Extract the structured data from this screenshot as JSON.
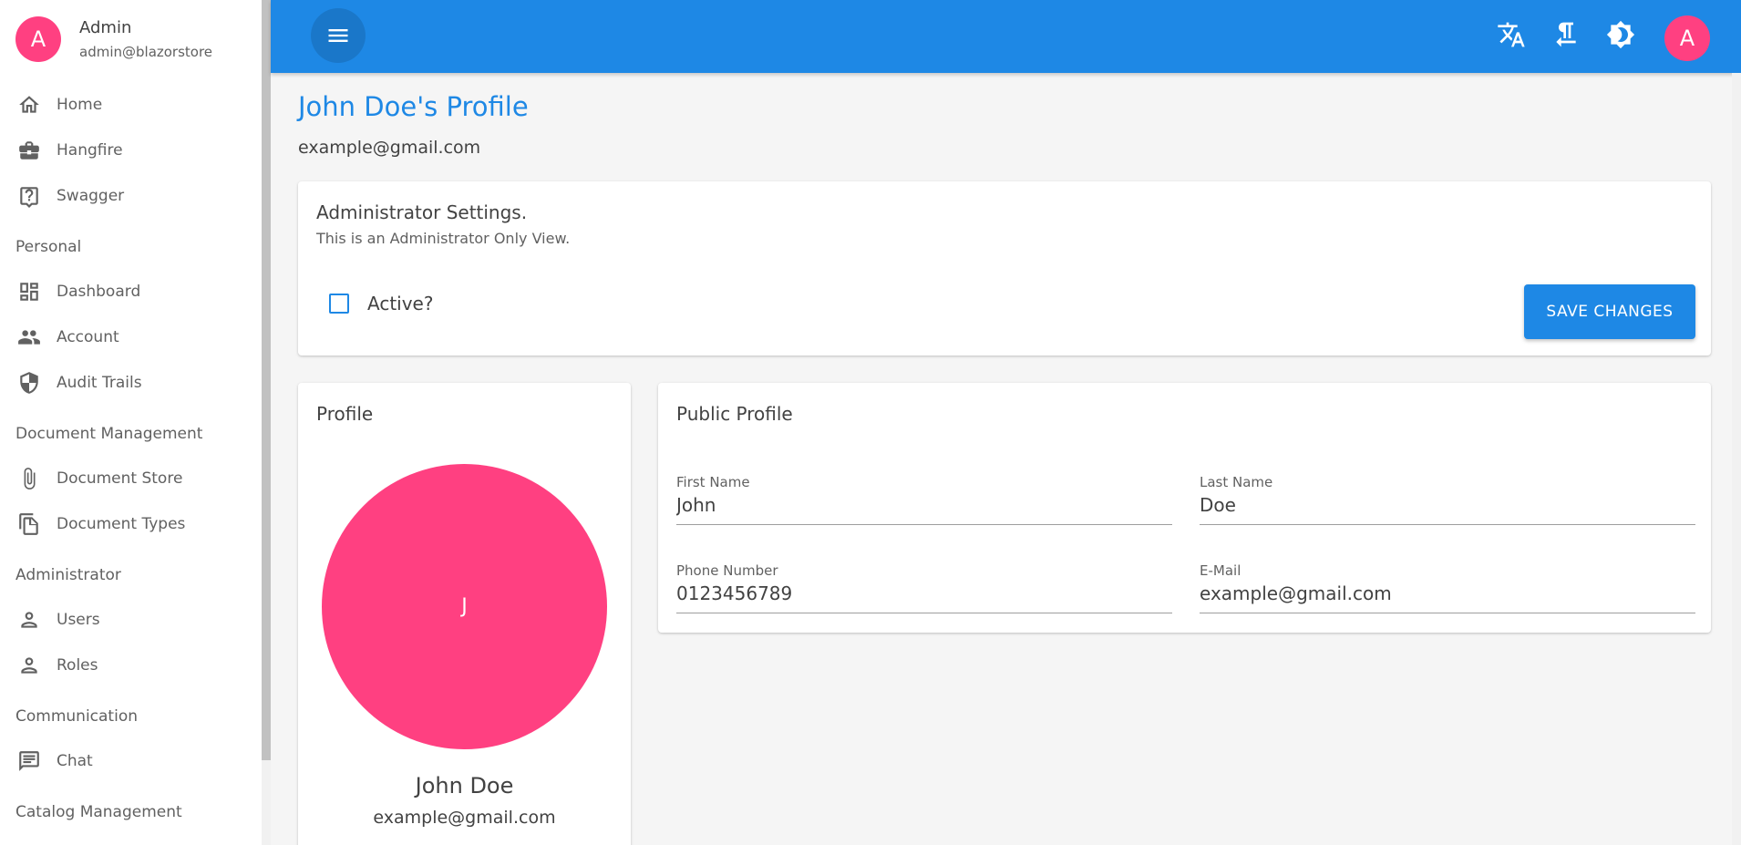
{
  "sidebar": {
    "user": {
      "initial": "A",
      "name": "Admin",
      "email": "admin@blazorstore"
    },
    "items": {
      "home": "Home",
      "hangfire": "Hangfire",
      "swagger": "Swagger",
      "group_personal": "Personal",
      "dashboard": "Dashboard",
      "account": "Account",
      "audit_trails": "Audit Trails",
      "group_document": "Document Management",
      "document_store": "Document Store",
      "document_types": "Document Types",
      "group_admin": "Administrator",
      "users": "Users",
      "roles": "Roles",
      "group_communication": "Communication",
      "chat": "Chat",
      "group_catalog": "Catalog Management"
    }
  },
  "appbar": {
    "avatar_initial": "A",
    "icons": [
      "menu-icon",
      "translate-icon",
      "rtl-direction-icon",
      "dark-mode-icon"
    ],
    "accent": "#1e88e5"
  },
  "page": {
    "title": "John Doe's Profile",
    "email": "example@gmail.com"
  },
  "admin_settings": {
    "title": "Administrator Settings.",
    "subtitle": "This is an Administrator Only View.",
    "active_label": "Active?",
    "active_checked": false,
    "save_label": "SAVE CHANGES"
  },
  "profile": {
    "title": "Profile",
    "initial": "J",
    "name": "John Doe",
    "email": "example@gmail.com",
    "avatar_color": "#ff4081"
  },
  "public_profile": {
    "title": "Public Profile",
    "first_name": {
      "label": "First Name",
      "value": "John"
    },
    "last_name": {
      "label": "Last Name",
      "value": "Doe"
    },
    "phone": {
      "label": "Phone Number",
      "value": "0123456789"
    },
    "email": {
      "label": "E-Mail",
      "value": "example@gmail.com"
    }
  }
}
